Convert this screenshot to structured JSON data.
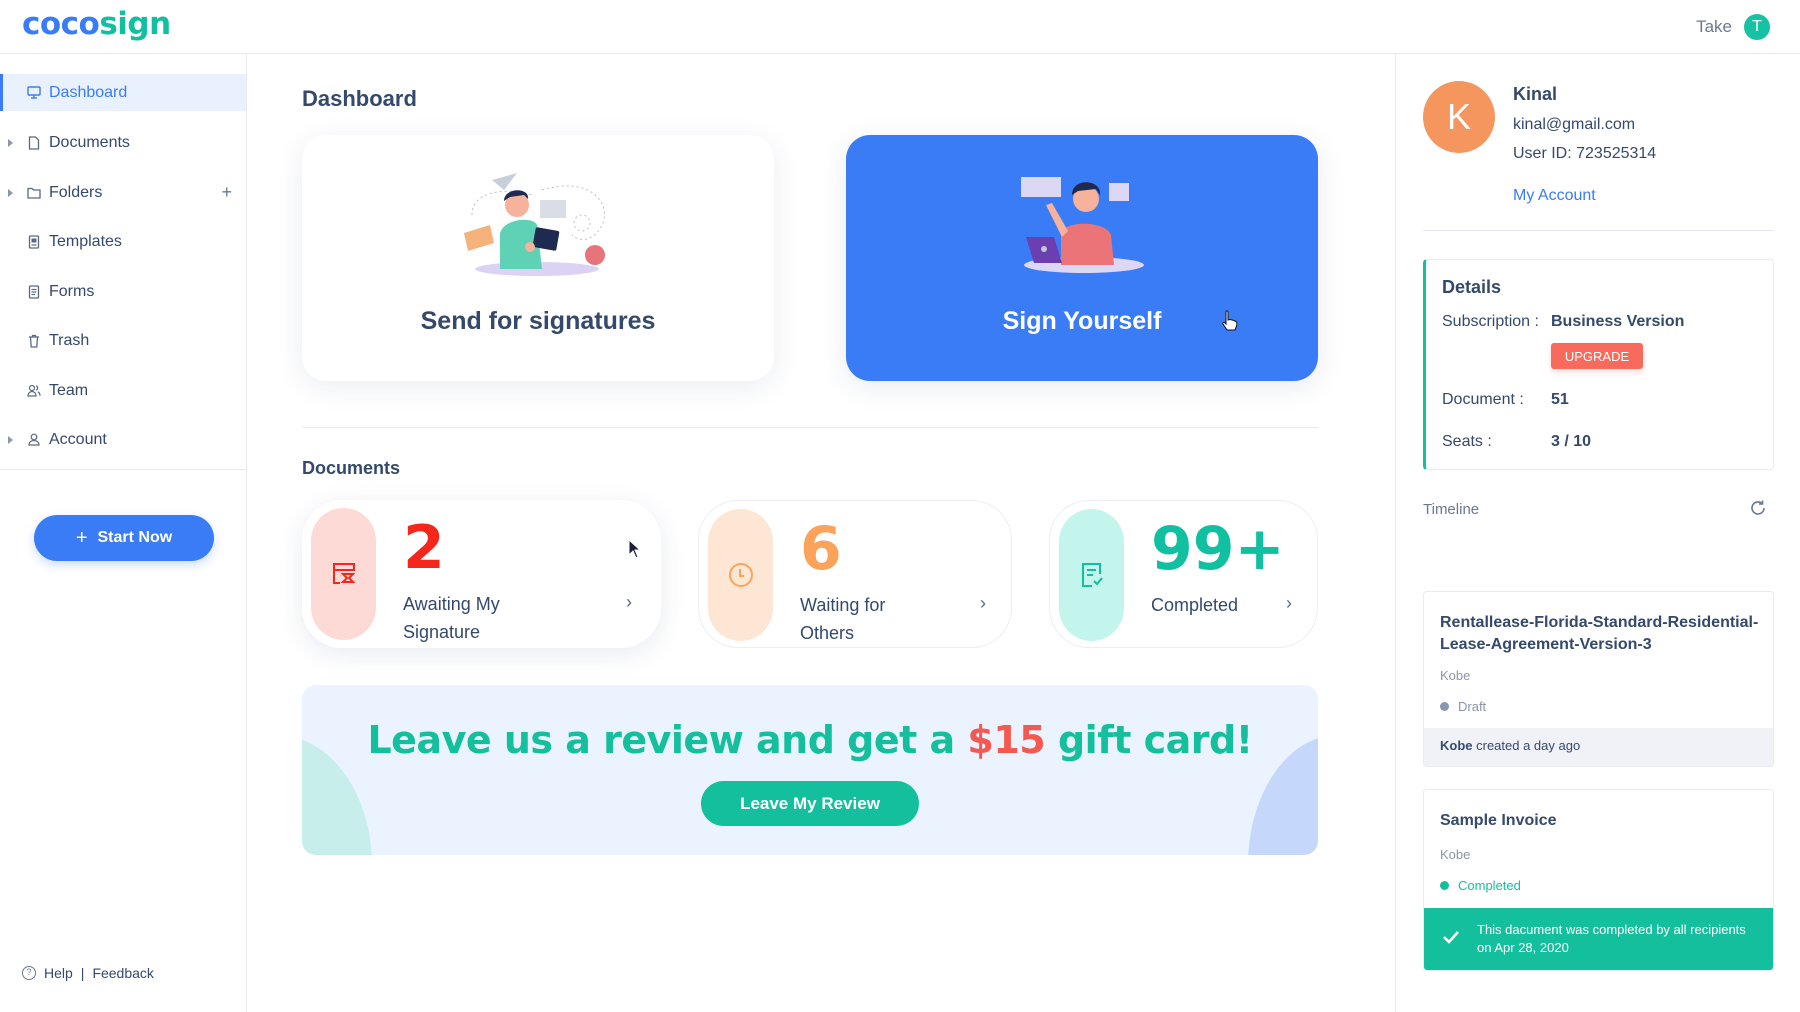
{
  "header": {
    "logo_part1": "coco",
    "logo_part2": "sign",
    "user_name": "Take",
    "user_initial": "T"
  },
  "sidebar": {
    "items": [
      {
        "label": "Dashboard",
        "icon": "monitor-icon",
        "active": true,
        "expandable": false
      },
      {
        "label": "Documents",
        "icon": "file-icon",
        "active": false,
        "expandable": true
      },
      {
        "label": "Folders",
        "icon": "folder-icon",
        "active": false,
        "expandable": true,
        "has_add": true
      },
      {
        "label": "Templates",
        "icon": "template-icon",
        "active": false,
        "expandable": false
      },
      {
        "label": "Forms",
        "icon": "form-icon",
        "active": false,
        "expandable": false
      },
      {
        "label": "Trash",
        "icon": "trash-icon",
        "active": false,
        "expandable": false
      },
      {
        "label": "Team",
        "icon": "team-icon",
        "active": false,
        "expandable": false
      },
      {
        "label": "Account",
        "icon": "user-icon",
        "active": false,
        "expandable": true
      }
    ],
    "add_symbol": "+",
    "start_button": "Start Now",
    "help_label": "Help",
    "separator": "|",
    "feedback_label": "Feedback"
  },
  "main": {
    "title": "Dashboard",
    "actions": {
      "send": "Send for signatures",
      "sign": "Sign Yourself"
    },
    "documents_title": "Documents",
    "stats": [
      {
        "count": "2",
        "label": "Awaiting My Signature",
        "color": "#f5261b",
        "pill_color": "#fddad6",
        "icon": "hourglass-doc-icon"
      },
      {
        "count": "6",
        "label": "Waiting for Others",
        "color": "#fba35a",
        "pill_color": "#fde7d4",
        "icon": "clock-icon"
      },
      {
        "count": "99+",
        "label": "Completed",
        "color": "#11c0a0",
        "pill_color": "#c4f5ec",
        "icon": "doc-check-icon"
      }
    ],
    "chevron": "›",
    "banner": {
      "text_before": "Leave us a review and get a ",
      "amount": "$15",
      "text_after": " gift card!",
      "button": "Leave My Review"
    }
  },
  "profile": {
    "initial": "K",
    "name": "Kinal",
    "email": "kinal@gmail.com",
    "user_id": "User ID: 723525314",
    "my_account": "My Account"
  },
  "details": {
    "title": "Details",
    "subscription_label": "Subscription :",
    "subscription_value": "Business Version",
    "upgrade": "UPGRADE",
    "document_label": "Document :",
    "document_value": "51",
    "seats_label": "Seats :",
    "seats_value": "3 / 10"
  },
  "timeline": {
    "label": "Timeline",
    "items": [
      {
        "title": "Rentallease-Florida-Standard-Residential-Lease-Agreement-Version-3",
        "owner": "Kobe",
        "status": "Draft",
        "status_color": "#8a96ab",
        "footer_actor": "Kobe",
        "footer_text": " created a day ago"
      },
      {
        "title": "Sample Invoice",
        "owner": "Kobe",
        "status": "Completed",
        "status_color": "#14bf9e",
        "footer_text": "This dacument was completed by all recipients on Apr 28, 2020"
      }
    ]
  }
}
